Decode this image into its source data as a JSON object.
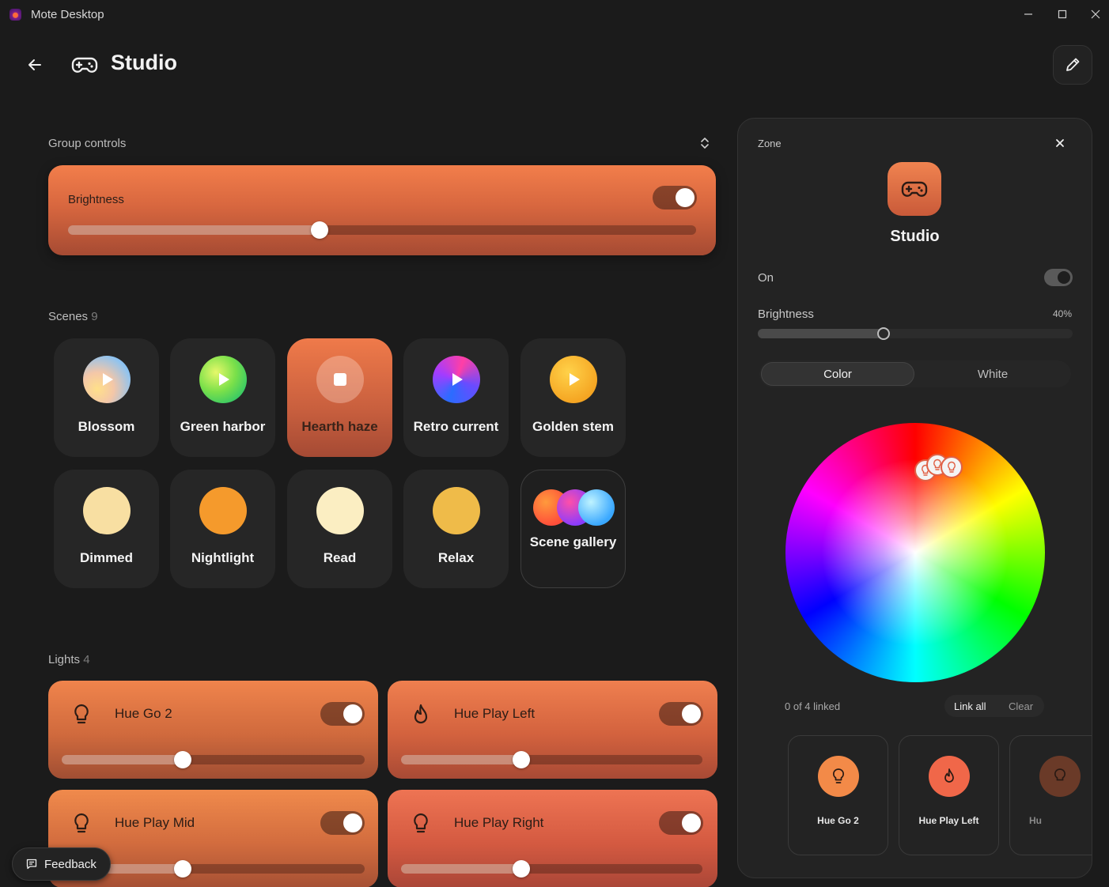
{
  "window": {
    "title": "Mote Desktop"
  },
  "header": {
    "title": "Studio"
  },
  "group_controls": {
    "label": "Group controls",
    "brightness_label": "Brightness",
    "brightness_level": 0.4,
    "on": true
  },
  "scenes": {
    "label": "Scenes",
    "count": "9",
    "items": [
      {
        "name": "Blossom",
        "active": false
      },
      {
        "name": "Green harbor",
        "active": false
      },
      {
        "name": "Hearth haze",
        "active": true
      },
      {
        "name": "Retro current",
        "active": false
      },
      {
        "name": "Golden stem",
        "active": false
      },
      {
        "name": "Dimmed",
        "active": false
      },
      {
        "name": "Nightlight",
        "active": false
      },
      {
        "name": "Read",
        "active": false
      },
      {
        "name": "Relax",
        "active": false
      },
      {
        "name": "Scene gallery",
        "active": false
      }
    ]
  },
  "lights": {
    "label": "Lights",
    "count": "4",
    "items": [
      {
        "name": "Hue Go 2",
        "icon": "bulb-icon",
        "on": true,
        "brightness": 0.4
      },
      {
        "name": "Hue Play Left",
        "icon": "flame-icon",
        "on": true,
        "brightness": 0.4
      },
      {
        "name": "Hue Play Mid",
        "icon": "bulb-icon",
        "on": true,
        "brightness": 0.4
      },
      {
        "name": "Hue Play Right",
        "icon": "bulb-icon",
        "on": true,
        "brightness": 0.4
      }
    ]
  },
  "zone_panel": {
    "label": "Zone",
    "title": "Studio",
    "on_label": "On",
    "brightness_label": "Brightness",
    "brightness_value": "40%",
    "brightness_level": 0.4,
    "tabs": [
      "Color",
      "White"
    ],
    "active_tab": "Color",
    "linked_text": "0 of 4 linked",
    "link_all_label": "Link all",
    "clear_label": "Clear",
    "lights": [
      {
        "name": "Hue Go 2",
        "icon": "bulb-icon"
      },
      {
        "name": "Hue Play Left",
        "icon": "flame-icon"
      },
      {
        "name": "Hu",
        "icon": "bulb-icon"
      }
    ]
  },
  "feedback": {
    "label": "Feedback"
  },
  "colors": {
    "accent_orange": "#e8704a",
    "background": "#1b1b1b",
    "panel": "#232323"
  }
}
